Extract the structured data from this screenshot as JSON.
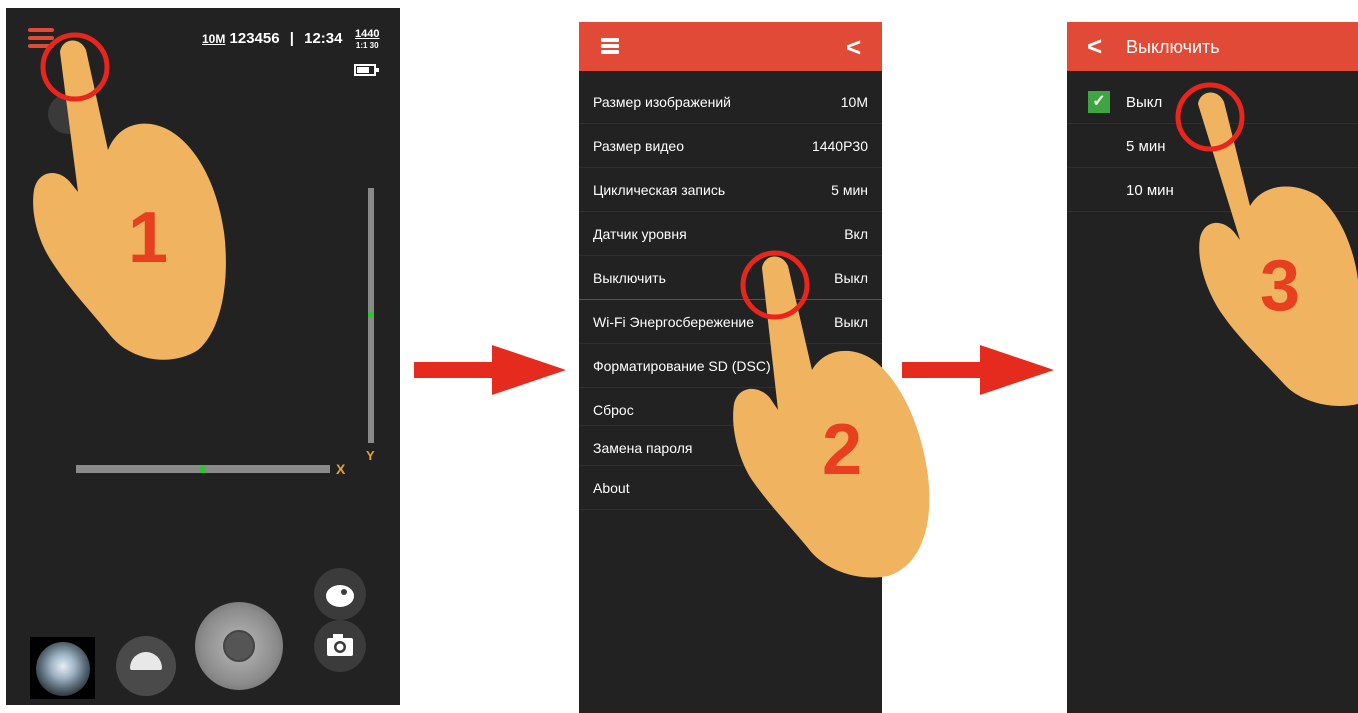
{
  "camera_screen": {
    "resolution": "10M",
    "counter": "123456",
    "separator": "|",
    "time": "12:34",
    "video_badge_top": "1440",
    "video_badge_bottom": "1:1 30",
    "y_label": "Y",
    "x_label": "X"
  },
  "settings_screen": {
    "items": [
      {
        "label": "Размер изображений",
        "value": "10M"
      },
      {
        "label": "Размер видео",
        "value": "1440P30"
      },
      {
        "label": "Циклическая запись",
        "value": "5 мин"
      },
      {
        "label": "Датчик уровня",
        "value": "Вкл"
      },
      {
        "label": "Выключить",
        "value": "Выкл"
      },
      {
        "label": "Wi-Fi Энергосбережение",
        "value": "Выкл"
      },
      {
        "label": "Форматирование SD (DSC)",
        "value": ""
      },
      {
        "label": "Сброс",
        "value": ""
      },
      {
        "label": "Замена пароля",
        "value": ""
      },
      {
        "label": "About",
        "value": ""
      }
    ]
  },
  "poweroff_screen": {
    "title": "Выключить",
    "options": [
      {
        "label": "Выкл",
        "selected": true
      },
      {
        "label": "5 мин",
        "selected": false
      },
      {
        "label": "10 мин",
        "selected": false
      }
    ]
  },
  "steps": [
    "1",
    "2",
    "3"
  ],
  "colors": {
    "accent": "#e04a36",
    "background": "#222222",
    "check": "#3fa543",
    "level_indicator": "#36c03a",
    "axis_label": "#e8a23a",
    "hand": "#f0b460",
    "arrow": "#e52b1d"
  }
}
